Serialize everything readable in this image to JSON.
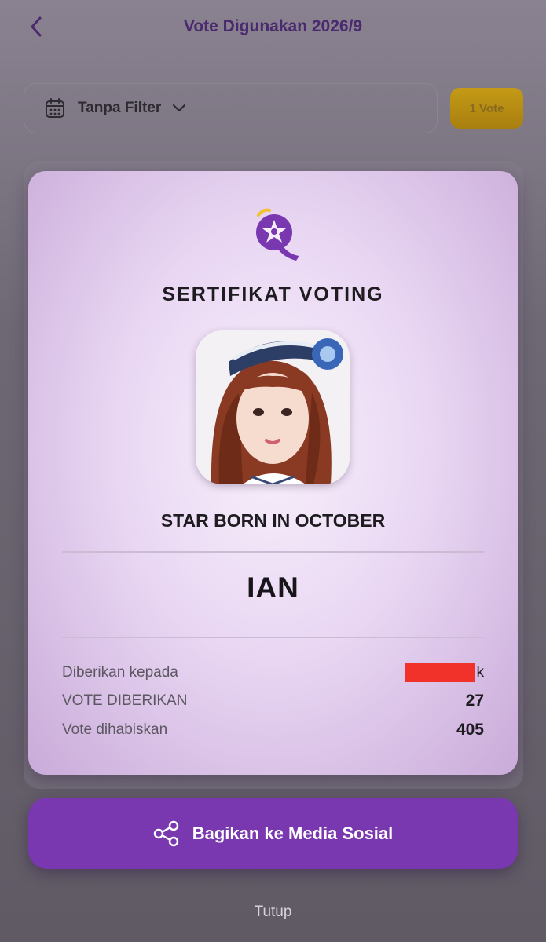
{
  "header": {
    "title": "Vote Digunakan 2026/9",
    "back_icon": "chevron-left-icon"
  },
  "filter": {
    "label": "Tanpa Filter",
    "icon": "calendar-icon"
  },
  "vote_chip": {
    "label": "1 Vote"
  },
  "certificate": {
    "title": "SERTIFIKAT VOTING",
    "event_name": "STAR BORN IN OCTOBER",
    "idol_name": "IAN",
    "rows": [
      {
        "label": "Diberikan kepada",
        "value": "k"
      },
      {
        "label": "VOTE DIBERIKAN",
        "value": "27"
      },
      {
        "label": "Vote dihabiskan",
        "value": "405"
      }
    ]
  },
  "share_button": {
    "label": "Bagikan ke Media Sosial",
    "icon": "share-icon"
  },
  "close_link": {
    "label": "Tutup"
  },
  "colors": {
    "accent_purple": "#7a38b0",
    "title_purple": "#4a2a6e",
    "chip_gold": "#c49a16",
    "redaction": "#f0322a"
  }
}
